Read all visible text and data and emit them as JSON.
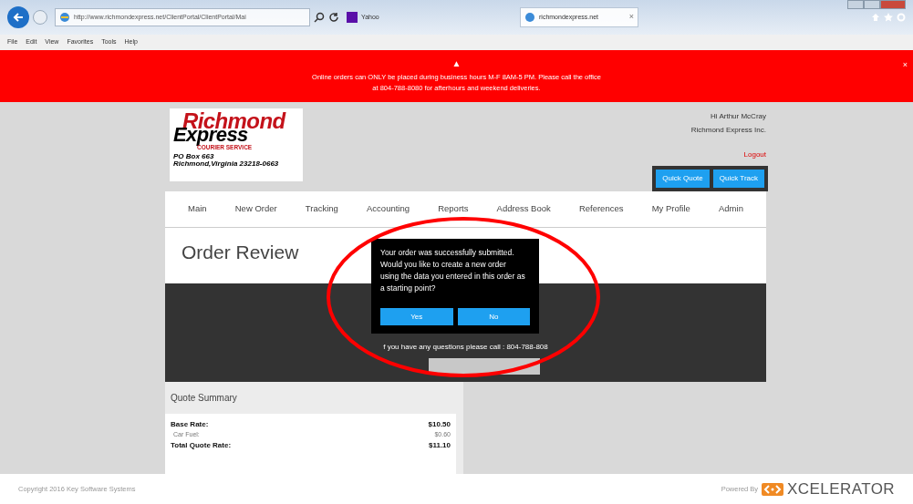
{
  "browser": {
    "address": "http://www.richmondexpress.net/ClientPortal/ClientPortal/Mai",
    "tabs": [
      {
        "label": "Yahoo",
        "selected": false
      },
      {
        "label": "richmondexpress.net",
        "selected": true
      }
    ],
    "close_tab": "×",
    "menu": [
      "File",
      "Edit",
      "View",
      "Favorites",
      "Tools",
      "Help"
    ]
  },
  "banner": {
    "icon": "▲",
    "message": "Online orders can ONLY be placed during business hours M-F 8AM-5 PM. Please call the office at 804-788-8080 for afterhours and weekend deliveries.",
    "close": "×"
  },
  "logo": {
    "line_1": "Richmond",
    "line_2": "Express",
    "tagline": "COURIER SERVICE",
    "address_1": "PO Box 663",
    "address_2": "Richmond,Virginia 23218-0663"
  },
  "user": {
    "greeting": "Hi Arthur McCray",
    "company": "Richmond Express Inc.",
    "logout": "Logout"
  },
  "quick_buttons": [
    "Quick Quote",
    "Quick Track"
  ],
  "nav": [
    "Main",
    "New Order",
    "Tracking",
    "Accounting",
    "Reports",
    "Address Book",
    "References",
    "My Profile",
    "Admin"
  ],
  "page_title": "Order Review",
  "contact": "f you have any questions please call : 804-788-808",
  "dialog": {
    "message": "Your order was successfully submitted. Would you like to create a new order using the data you entered in this order as a starting point?",
    "buttons": [
      "Yes",
      "No"
    ]
  },
  "quote_summary": {
    "title": "Quote Summary",
    "rows": [
      {
        "kind": "main",
        "label": "Base Rate:",
        "value": "$10.50"
      },
      {
        "kind": "sub",
        "label": "Car Fuel:",
        "value": "$0.60"
      },
      {
        "kind": "main",
        "label": "Total Quote Rate:",
        "value": "$11.10"
      }
    ]
  },
  "footer": {
    "copyright": "Copyright 2016 Key Software Systems",
    "powered_by": "Powered By",
    "brand": "XCELERATOR"
  }
}
